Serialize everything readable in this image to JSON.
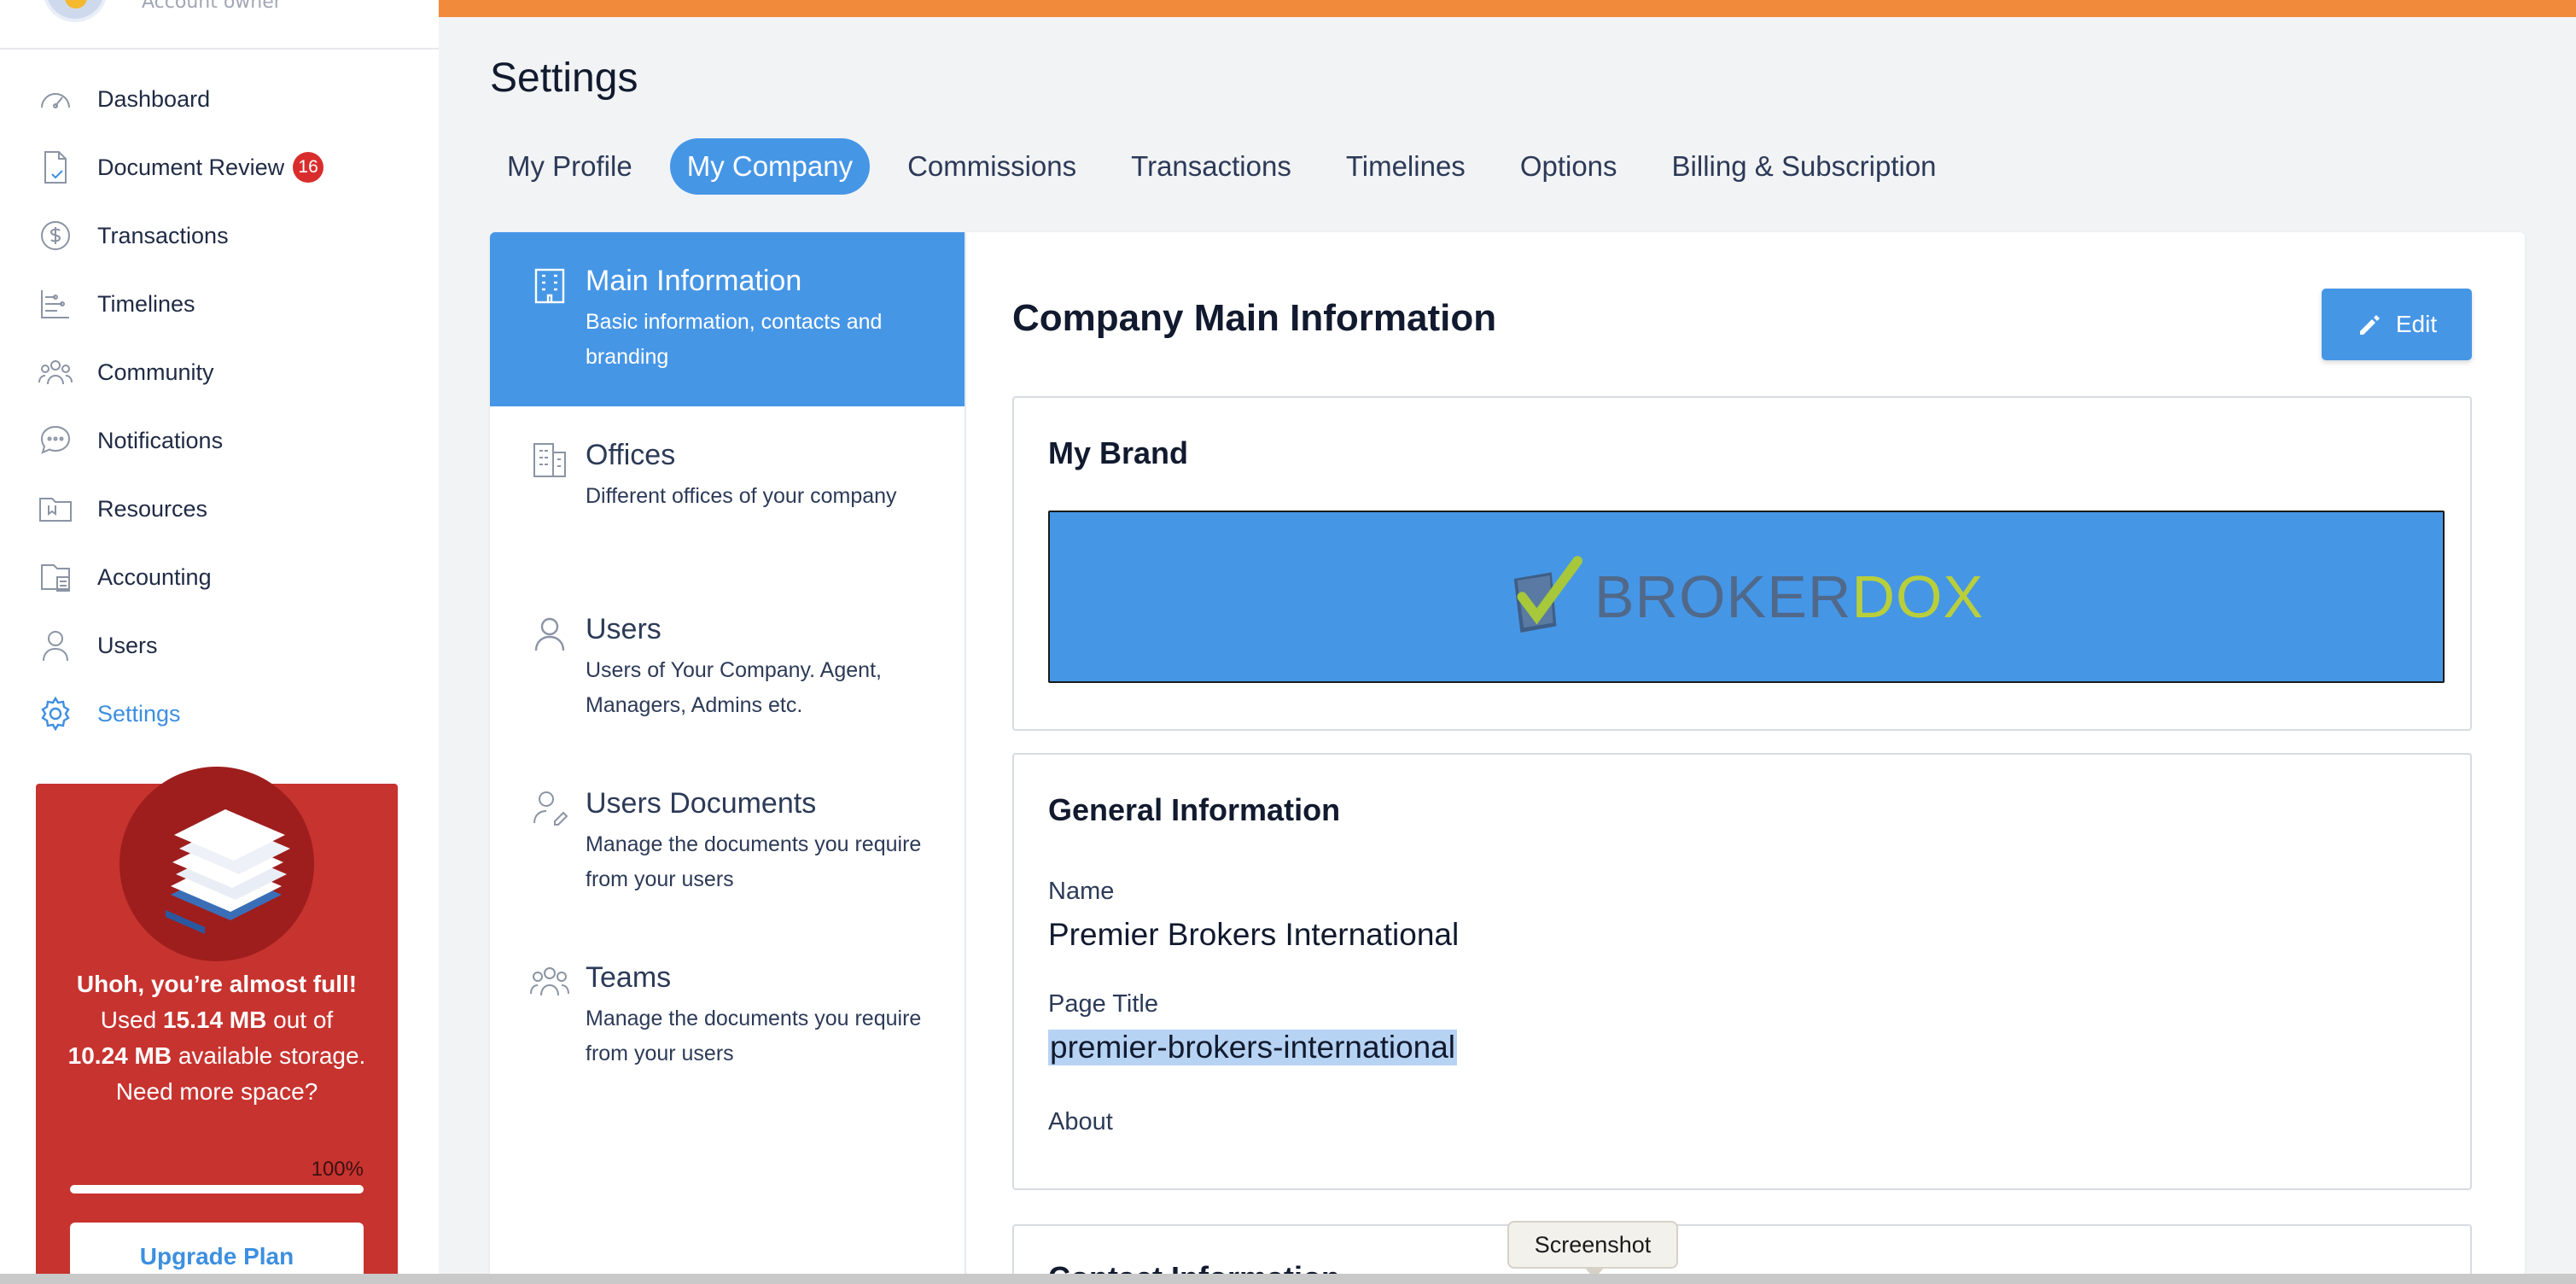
{
  "profile": {
    "role": "Account owner"
  },
  "sidebar": {
    "items": [
      {
        "label": "Dashboard",
        "icon": "speedometer-icon"
      },
      {
        "label": "Document Review",
        "icon": "document-check-icon",
        "badge": "16"
      },
      {
        "label": "Transactions",
        "icon": "dollar-circle-icon"
      },
      {
        "label": "Timelines",
        "icon": "timeline-icon"
      },
      {
        "label": "Community",
        "icon": "community-icon"
      },
      {
        "label": "Notifications",
        "icon": "chat-bubble-icon"
      },
      {
        "label": "Resources",
        "icon": "folder-icon"
      },
      {
        "label": "Accounting",
        "icon": "calculator-icon"
      },
      {
        "label": "Users",
        "icon": "user-icon"
      },
      {
        "label": "Settings",
        "icon": "gear-icon",
        "active": true
      }
    ],
    "storage": {
      "headline": "Uhoh, you’re almost full!",
      "used_prefix": "Used",
      "used": "15.14 MB",
      "out_of": "out of",
      "available": "10.24 MB",
      "available_suffix": "available storage.",
      "need_more": "Need more space?",
      "percent_label": "100%",
      "percent": 100,
      "button": "Upgrade Plan"
    }
  },
  "header": {
    "title": "Settings",
    "tabs": [
      {
        "label": "My Profile"
      },
      {
        "label": "My Company",
        "active": true
      },
      {
        "label": "Commissions"
      },
      {
        "label": "Transactions"
      },
      {
        "label": "Timelines"
      },
      {
        "label": "Options"
      },
      {
        "label": "Billing & Subscription"
      }
    ]
  },
  "subnav": {
    "items": [
      {
        "title": "Main Information",
        "desc": "Basic information, contacts and branding",
        "icon": "building-icon",
        "active": true
      },
      {
        "title": "Offices",
        "desc": "Different offices of your company",
        "icon": "office-icon"
      },
      {
        "title": "Users",
        "desc": "Users of Your Company. Agent, Managers, Admins etc.",
        "icon": "user-icon"
      },
      {
        "title": "Users Documents",
        "desc": "Manage the documents you require from your users",
        "icon": "user-document-icon"
      },
      {
        "title": "Teams",
        "desc": "Manage the documents you require from your users",
        "icon": "team-icon"
      }
    ]
  },
  "main": {
    "title": "Company Main Information",
    "edit_label": "Edit",
    "brand": {
      "title": "My Brand",
      "logo_part1": "BROKER",
      "logo_part2": "DOX"
    },
    "general": {
      "title": "General Information",
      "name_label": "Name",
      "name_value": "Premier Brokers International",
      "page_title_label": "Page Title",
      "page_title_value": "premier-brokers-international",
      "about_label": "About"
    },
    "contact": {
      "title": "Contact Information"
    }
  },
  "tooltip": {
    "text": "Screenshot"
  },
  "colors": {
    "accent": "#4696e6",
    "topbar": "#f28a3c",
    "storage_bg": "#c7332f",
    "badge": "#d92d2d"
  }
}
